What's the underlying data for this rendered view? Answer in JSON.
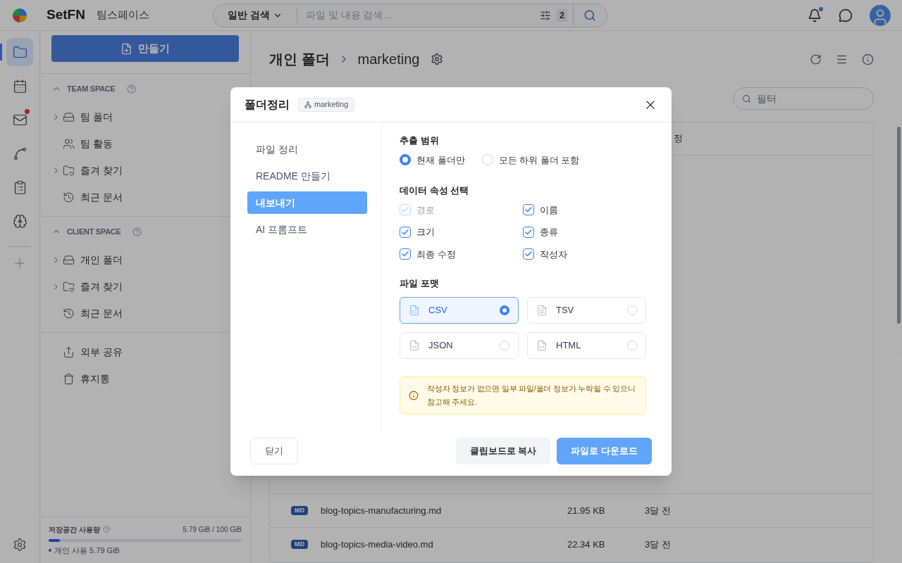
{
  "app": {
    "brand": "SetFN",
    "workspace": "팀스페이스"
  },
  "search": {
    "mode": "일반 검색",
    "placeholder": "파일 및 내용 검색...",
    "filter_count": "2"
  },
  "header": {
    "notification_unread": true
  },
  "rail": [
    {
      "selected": true,
      "badge": false
    },
    {
      "selected": false,
      "badge": false
    },
    {
      "selected": false,
      "badge": true
    },
    {
      "selected": false,
      "badge": false
    },
    {
      "selected": false,
      "badge": false
    },
    {
      "selected": false,
      "badge": false
    }
  ],
  "create_button": "만들기",
  "sections": [
    {
      "title": "TEAM SPACE",
      "expanded": true,
      "items": [
        {
          "label": "팀 폴더",
          "kind": "drive",
          "expandable": true
        },
        {
          "label": "팀 활동",
          "kind": "people",
          "expandable": false
        },
        {
          "label": "즐겨 찾기",
          "kind": "star-folder",
          "expandable": true
        },
        {
          "label": "최근 문서",
          "kind": "history",
          "expandable": false
        }
      ]
    },
    {
      "title": "CLIENT SPACE",
      "expanded": true,
      "items": [
        {
          "label": "개인 폴더",
          "kind": "drive",
          "expandable": true
        },
        {
          "label": "즐겨 찾기",
          "kind": "star-folder",
          "expandable": true
        },
        {
          "label": "최근 문서",
          "kind": "history",
          "expandable": false
        }
      ]
    }
  ],
  "extra_items": [
    {
      "label": "외부 공유",
      "kind": "share"
    },
    {
      "label": "휴지통",
      "kind": "trash"
    }
  ],
  "storage": {
    "label": "저장공간 사용량",
    "usage": "5.79 GiB / 100 GiB",
    "level": 0.058,
    "legend": "개인 사용 5.79 GiB"
  },
  "breadcrumb": [
    "개인 폴더",
    "marketing"
  ],
  "filter": {
    "placeholder": "필터"
  },
  "table": {
    "column_4_heading": "정",
    "rows": [
      {
        "badge": "MD",
        "name": "blog-topics-manufacturing.md",
        "size": "21.95 KB",
        "modified": "3달 전"
      },
      {
        "badge": "MD",
        "name": "blog-topics-media-video.md",
        "size": "22.34 KB",
        "modified": "3달 전"
      }
    ]
  },
  "dialog": {
    "title": "폴더정리",
    "chip": "marketing",
    "nav": [
      {
        "label": "파일 정리",
        "selected": false
      },
      {
        "label": "README 만들기",
        "selected": false
      },
      {
        "label": "내보내기",
        "selected": true
      },
      {
        "label": "AI 프롬프트",
        "selected": false
      }
    ],
    "scope": {
      "title": "추출 범위",
      "options": [
        {
          "label": "현재 폴더만",
          "selected": true
        },
        {
          "label": "모든 하위 폴더 포함",
          "selected": false
        }
      ]
    },
    "attributes": {
      "title": "데이터 속성 선택",
      "items": [
        {
          "label": "경로",
          "checked": true,
          "disabled": true
        },
        {
          "label": "이름",
          "checked": true,
          "disabled": false
        },
        {
          "label": "크기",
          "checked": true,
          "disabled": false
        },
        {
          "label": "종류",
          "checked": true,
          "disabled": false
        },
        {
          "label": "최종 수정",
          "checked": true,
          "disabled": false
        },
        {
          "label": "작성자",
          "checked": true,
          "disabled": false
        }
      ]
    },
    "format": {
      "title": "파일 포맷",
      "options": [
        {
          "label": "CSV",
          "kind": "csv",
          "selected": true
        },
        {
          "label": "TSV",
          "kind": "tsv",
          "selected": false
        },
        {
          "label": "JSON",
          "kind": "json",
          "selected": false
        },
        {
          "label": "HTML",
          "kind": "html",
          "selected": false
        }
      ]
    },
    "notice": "작성자 정보가 없으면 일부 파일/폴더 정보가 누락될 수 있으니 참고해 주세요.",
    "close_button": "닫기",
    "copy_button": "클립보드로 복사",
    "download_button": "파일로 다운로드"
  }
}
